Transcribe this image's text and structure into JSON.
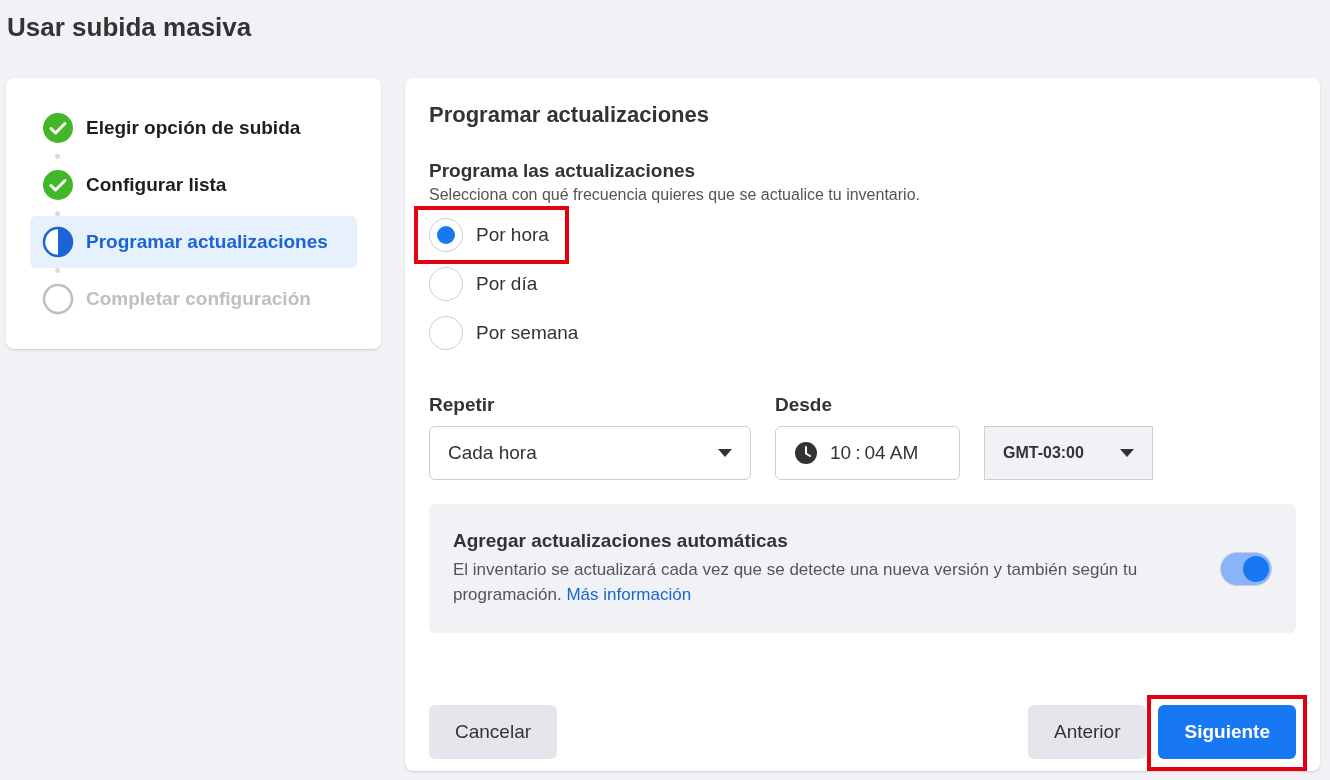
{
  "page": {
    "title": "Usar subida masiva"
  },
  "steps": [
    {
      "label": "Elegir opción de subida",
      "completed": true,
      "selected": false
    },
    {
      "label": "Configurar lista",
      "completed": true,
      "selected": false
    },
    {
      "label": "Programar actualizaciones",
      "completed": false,
      "selected": true
    },
    {
      "label": "Completar configuración",
      "completed": false,
      "selected": false
    }
  ],
  "panel": {
    "title": "Programar actualizaciones",
    "section_title": "Programa las actualizaciones",
    "section_subtitle": "Selecciona con qué frecuencia quieres que se actualice tu inventario.",
    "options": [
      {
        "label": "Por hora",
        "selected": true,
        "highlighted": true
      },
      {
        "label": "Por día",
        "selected": false,
        "highlighted": false
      },
      {
        "label": "Por semana",
        "selected": false,
        "highlighted": false
      }
    ],
    "repeat": {
      "label": "Repetir",
      "value": "Cada hora"
    },
    "from": {
      "label": "Desde",
      "hour": "10",
      "separator": ":",
      "minute": "04 AM",
      "timezone": "GMT-03:00"
    },
    "auto_updates": {
      "title": "Agregar actualizaciones automáticas",
      "text": "El inventario se actualizará cada vez que se detecte una nueva versión y también según tu programación.",
      "link": "Más información",
      "on": true
    },
    "buttons": [
      {
        "label": "Cancelar",
        "kind": "secondary",
        "highlighted": false
      },
      {
        "label": "Anterior",
        "kind": "secondary",
        "highlighted": false
      },
      {
        "label": "Siguiente",
        "kind": "primary",
        "highlighted": true
      }
    ]
  }
}
